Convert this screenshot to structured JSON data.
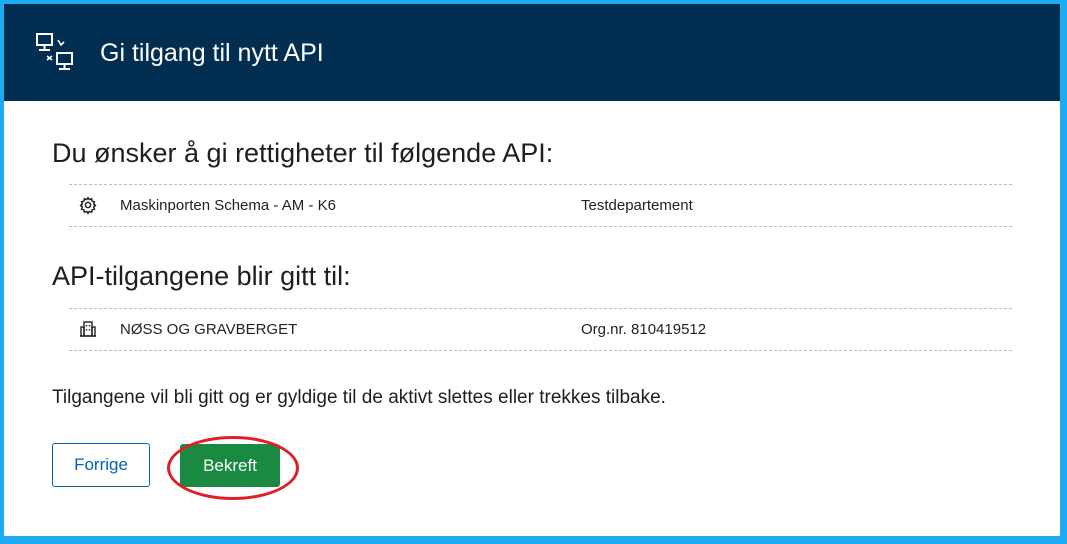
{
  "colors": {
    "frame": "#1eaaf1",
    "header_bg": "#022f51",
    "primary_button": "#1a8a43",
    "secondary_button_border": "#0062ba",
    "highlight": "#e31d25"
  },
  "header": {
    "icon": "network-transfer-icon",
    "title": "Gi tilgang til nytt API"
  },
  "api_section": {
    "heading": "Du ønsker å gi rettigheter til følgende API:",
    "items": [
      {
        "icon": "gear-icon",
        "name": "Maskinporten Schema - AM - K6",
        "owner": "Testdepartement"
      }
    ]
  },
  "recipient_section": {
    "heading": "API-tilgangene blir gitt til:",
    "items": [
      {
        "icon": "building-icon",
        "name": "NØSS OG GRAVBERGET",
        "org": "Org.nr. 810419512"
      }
    ]
  },
  "info_text": "Tilgangene vil bli gitt og er gyldige til de aktivt slettes eller trekkes tilbake.",
  "actions": {
    "back_label": "Forrige",
    "confirm_label": "Bekreft"
  }
}
